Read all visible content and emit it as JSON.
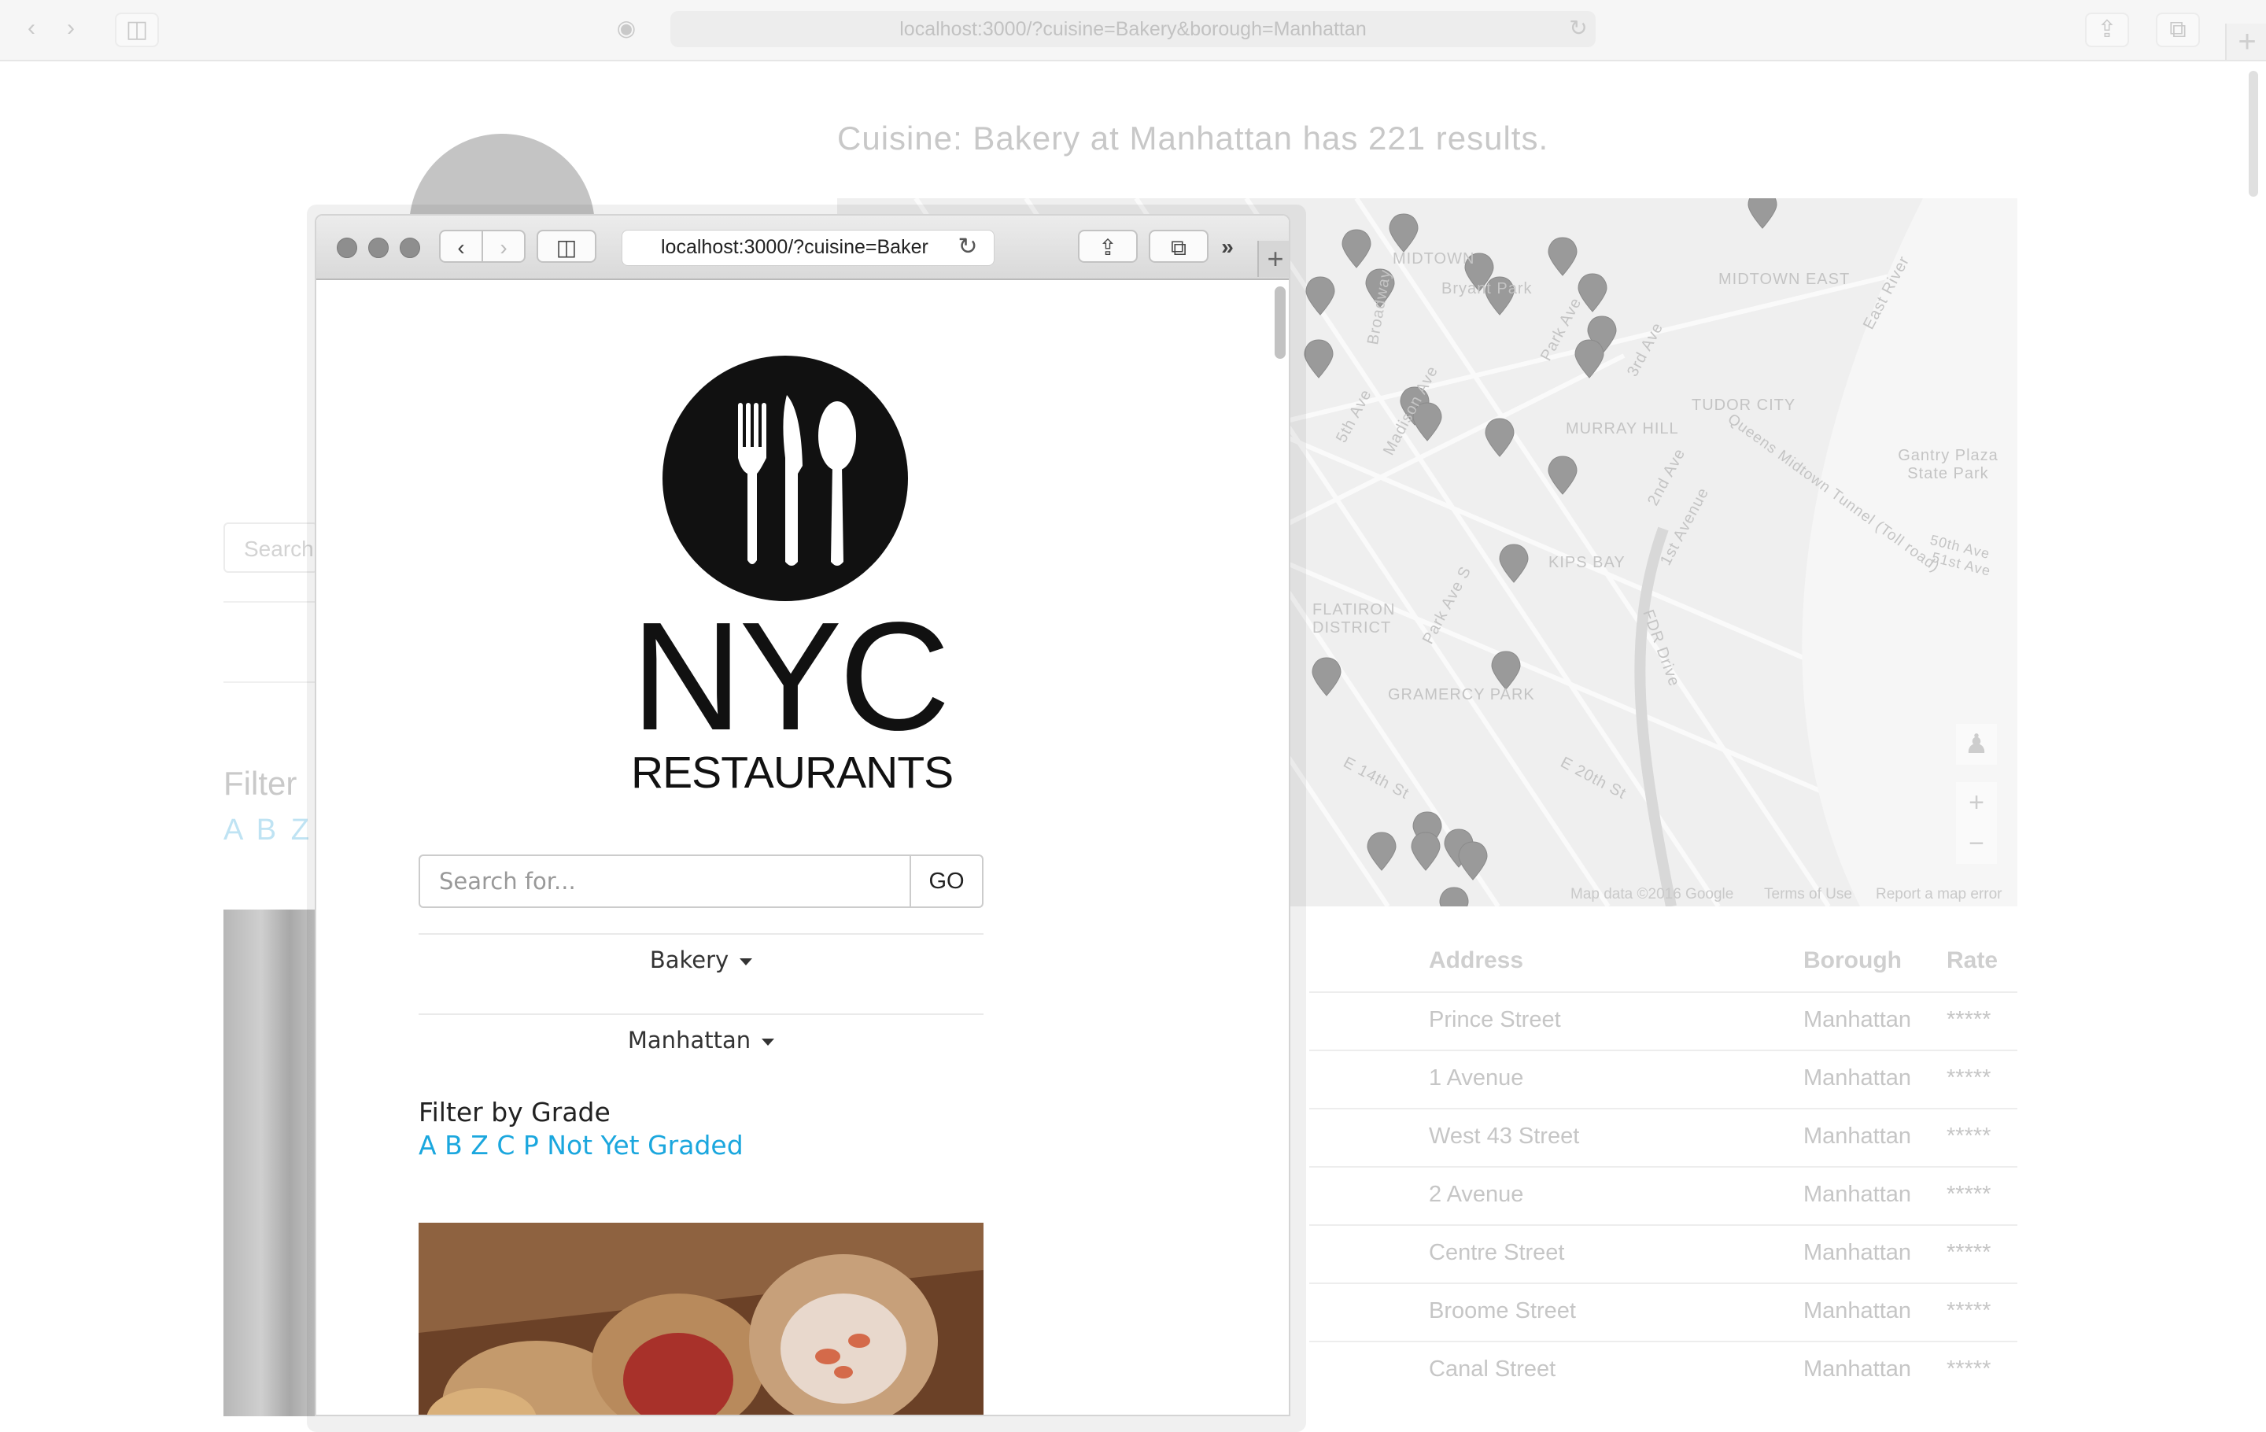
{
  "background": {
    "url": "localhost:3000/?cuisine=Bakery&borough=Manhattan",
    "heading": "Cuisine: Bakery at Manhattan has 221 results.",
    "search_placeholder": "Search",
    "filter_label": "Filter",
    "grades_partial": "A B Z",
    "map": {
      "labels": [
        "MIDTOWN",
        "Bryant Park",
        "MIDTOWN EAST",
        "TUDOR CITY",
        "MURRAY HILL",
        "Gantry Plaza State Park",
        "FLATIRON DISTRICT",
        "GRAMERCY PARK",
        "KIPS BAY",
        "Queens Midtown Tunnel (Toll road)",
        "FDR Drive",
        "5th Ave",
        "Madison Ave",
        "Park Ave",
        "Broadway",
        "3rd Ave",
        "2nd Ave",
        "1st Avenue",
        "E 20th St",
        "E 14th St",
        "50th Ave",
        "51st Ave",
        "East River",
        "Park Ave S"
      ],
      "footer": [
        "Map data ©2016 Google",
        "Terms of Use",
        "Report a map error"
      ],
      "zoom_in": "+",
      "zoom_out": "−"
    },
    "table": {
      "headers": [
        "Address",
        "Borough",
        "Rate"
      ],
      "rows": [
        {
          "address": "Prince Street",
          "borough": "Manhattan",
          "rate": "*****"
        },
        {
          "address": "1 Avenue",
          "borough": "Manhattan",
          "rate": "*****"
        },
        {
          "address": "West 43 Street",
          "borough": "Manhattan",
          "rate": "*****"
        },
        {
          "address": "2 Avenue",
          "borough": "Manhattan",
          "rate": "*****"
        },
        {
          "address": "Centre Street",
          "borough": "Manhattan",
          "rate": "*****"
        },
        {
          "address": "Broome Street",
          "borough": "Manhattan",
          "rate": "*****"
        },
        {
          "address": "Canal Street",
          "borough": "Manhattan",
          "rate": "*****"
        }
      ]
    }
  },
  "foreground": {
    "url": "localhost:3000/?cuisine=Baker",
    "logo": {
      "title": "NYC",
      "subtitle": "RESTAURANTS"
    },
    "search": {
      "placeholder": "Search for...",
      "button": "GO"
    },
    "cuisine_select": "Bakery",
    "borough_select": "Manhattan",
    "filter_label": "Filter by Grade",
    "grades": [
      "A",
      "B",
      "Z",
      "C",
      "P",
      "Not Yet Graded"
    ],
    "link_color": "#1ba7de"
  }
}
